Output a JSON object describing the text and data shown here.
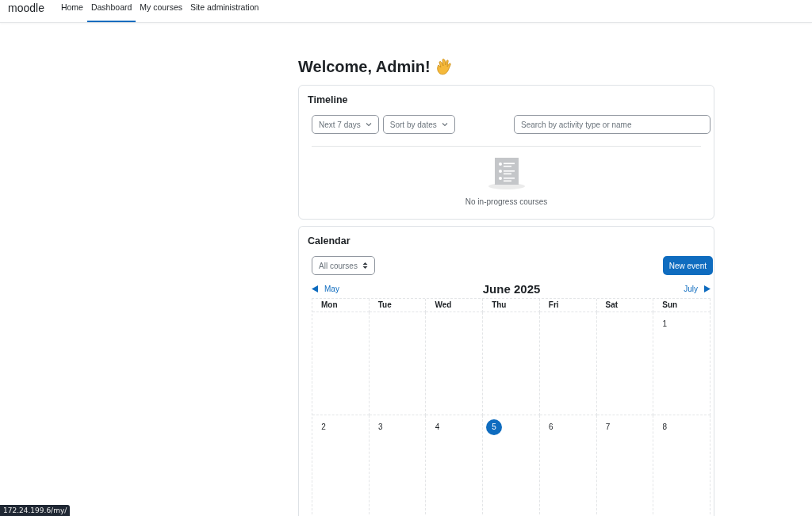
{
  "navbar": {
    "brand": "moodle",
    "items": [
      {
        "label": "Home",
        "selected": false
      },
      {
        "label": "Dashboard",
        "selected": true
      },
      {
        "label": "My courses",
        "selected": false
      },
      {
        "label": "Site administration",
        "selected": false
      }
    ]
  },
  "heading": "Welcome, Admin!",
  "timeline": {
    "title": "Timeline",
    "filters": [
      "Next 7 days",
      "Sort by dates"
    ],
    "search": {
      "placeholder": "Search by activity type or name"
    },
    "empty_message": "No in-progress courses"
  },
  "calendar": {
    "title": "Calendar",
    "course_filter": "All courses",
    "new_event": "New event",
    "prev": "May",
    "month": "June 2025",
    "next": "July",
    "weekdays": [
      "Mon",
      "Tue",
      "Wed",
      "Thu",
      "Fri",
      "Sat",
      "Sun"
    ],
    "weeks": [
      [
        {
          "kind": "blank"
        },
        {
          "kind": "blank"
        },
        {
          "kind": "blank"
        },
        {
          "kind": "blank"
        },
        {
          "kind": "blank"
        },
        {
          "kind": "blank"
        },
        {
          "kind": "day",
          "day": "1",
          "today": false
        }
      ],
      [
        {
          "kind": "day",
          "day": "2",
          "today": false
        },
        {
          "kind": "day",
          "day": "3",
          "today": false
        },
        {
          "kind": "day",
          "day": "4",
          "today": false
        },
        {
          "kind": "day",
          "day": "5",
          "today": true
        },
        {
          "kind": "day",
          "day": "6",
          "today": false
        },
        {
          "kind": "day",
          "day": "7",
          "today": false
        },
        {
          "kind": "day",
          "day": "8",
          "today": false
        }
      ]
    ]
  },
  "status_url": "172.24.199.6/my/"
}
